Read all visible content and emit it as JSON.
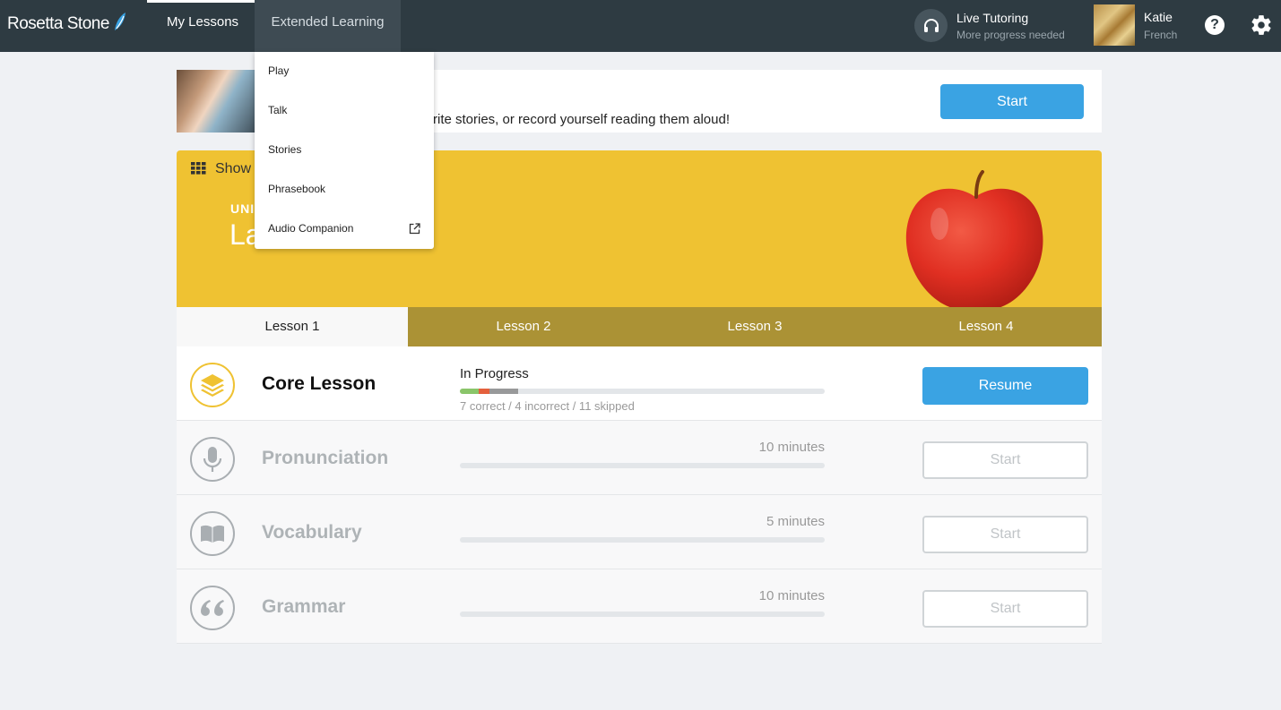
{
  "header": {
    "logo_text": "Rosetta Stone",
    "tabs": [
      {
        "label": "My Lessons"
      },
      {
        "label": "Extended Learning"
      }
    ],
    "live_tutoring": {
      "title": "Live Tutoring",
      "subtitle": "More progress needed",
      "icon": "headphones-icon"
    },
    "user": {
      "name": "Katie",
      "language": "French"
    },
    "help_icon": "?",
    "accent_color": "#2e3b42"
  },
  "dropdown": {
    "items": [
      {
        "label": "Play"
      },
      {
        "label": "Talk"
      },
      {
        "label": "Stories"
      },
      {
        "label": "Phrasebook"
      },
      {
        "label": "Audio Companion",
        "icon": "external-link-icon"
      }
    ]
  },
  "stories_card": {
    "description": "rite stories, or record yourself reading them aloud!",
    "start_label": "Start"
  },
  "unit": {
    "show_label": "Show",
    "unit_label": "UNI",
    "title": "La",
    "banner_color": "#efc232"
  },
  "lessons": {
    "tabs": [
      {
        "label": "Lesson 1"
      },
      {
        "label": "Lesson 2"
      },
      {
        "label": "Lesson 3"
      },
      {
        "label": "Lesson 4"
      }
    ]
  },
  "activities": [
    {
      "title": "Core Lesson",
      "icon": "layers-icon",
      "status": "In Progress",
      "progress": {
        "correct": 7,
        "incorrect": 4,
        "skipped": 11,
        "total_segments_of": 60
      },
      "score_text": "7 correct / 4 incorrect / 11 skipped",
      "button_label": "Resume"
    },
    {
      "title": "Pronunciation",
      "icon": "microphone-icon",
      "duration": "10 minutes",
      "button_label": "Start"
    },
    {
      "title": "Vocabulary",
      "icon": "book-icon",
      "duration": "5 minutes",
      "button_label": "Start"
    },
    {
      "title": "Grammar",
      "icon": "quote-icon",
      "duration": "10 minutes",
      "button_label": "Start"
    }
  ],
  "colors": {
    "primary_button": "#3aa3e3",
    "correct": "#8ac56a",
    "incorrect": "#e4603d",
    "skipped": "#98999a"
  }
}
